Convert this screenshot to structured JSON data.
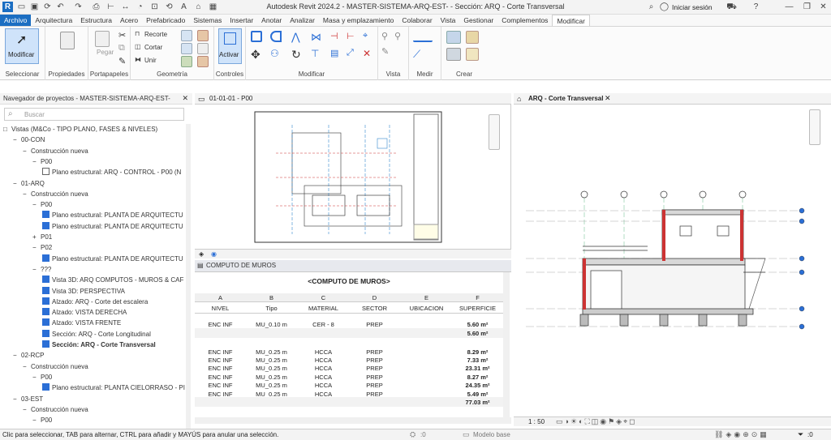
{
  "app": {
    "title": "Autodesk Revit 2024.2 - MASTER-SISTEMA-ARQ-EST- - Sección: ARQ - Corte Transversal",
    "signin": "Iniciar sesión"
  },
  "menu": {
    "tabs": [
      "Archivo",
      "Arquitectura",
      "Estructura",
      "Acero",
      "Prefabricado",
      "Sistemas",
      "Insertar",
      "Anotar",
      "Analizar",
      "Masa y emplazamiento",
      "Colaborar",
      "Vista",
      "Gestionar",
      "Complementos",
      "Modificar"
    ]
  },
  "ribbon": {
    "modify_label": "Modificar",
    "paste_label": "Pegar",
    "recorte_label": "Recorte",
    "cortar_label": "Cortar",
    "unir_label": "Unir",
    "activar_label": "Activar",
    "groups": [
      "Seleccionar",
      "Propiedades",
      "Portapapeles",
      "Geometría",
      "Controles",
      "Modificar",
      "Vista",
      "Medir",
      "Crear"
    ]
  },
  "browser": {
    "header": "Navegador de proyectos - MASTER-SISTEMA-ARQ-EST-",
    "search_placeholder": "Buscar",
    "items": [
      {
        "text": "Vistas (M&Co - TIPO PLANO, FASES & NIVELES)",
        "prefix": "□",
        "level": 0
      },
      {
        "text": "00-CON",
        "prefix": "−",
        "level": 1
      },
      {
        "text": "Construcción nueva",
        "prefix": "−",
        "level": 2
      },
      {
        "text": "P00",
        "prefix": "−",
        "level": 3
      },
      {
        "text": "Plano estructural: ARQ - CONTROL - P00 (N",
        "prefix": "",
        "level": 4,
        "icon": "plain"
      },
      {
        "text": "01-ARQ",
        "prefix": "−",
        "level": 1
      },
      {
        "text": "Construcción nueva",
        "prefix": "−",
        "level": 2
      },
      {
        "text": "P00",
        "prefix": "−",
        "level": 3
      },
      {
        "text": "Plano estructural: PLANTA DE ARQUITECTU",
        "prefix": "",
        "level": 4,
        "icon": "blue"
      },
      {
        "text": "Plano estructural: PLANTA DE ARQUITECTU",
        "prefix": "",
        "level": 4,
        "icon": "blue"
      },
      {
        "text": "P01",
        "prefix": "+",
        "level": 3
      },
      {
        "text": "P02",
        "prefix": "−",
        "level": 3
      },
      {
        "text": "Plano estructural: PLANTA DE ARQUITECTU",
        "prefix": "",
        "level": 4,
        "icon": "blue"
      },
      {
        "text": "???",
        "prefix": "−",
        "level": 3
      },
      {
        "text": "Vista 3D: ARQ COMPUTOS - MUROS & CAF",
        "prefix": "",
        "level": 4,
        "icon": "blue"
      },
      {
        "text": "Vista 3D: PERSPECTIVA",
        "prefix": "",
        "level": 4,
        "icon": "blue"
      },
      {
        "text": "Alzado: ARQ - Corte det escalera",
        "prefix": "",
        "level": 4,
        "icon": "blue"
      },
      {
        "text": "Alzado: VISTA DERECHA",
        "prefix": "",
        "level": 4,
        "icon": "blue"
      },
      {
        "text": "Alzado: VISTA FRENTE",
        "prefix": "",
        "level": 4,
        "icon": "blue"
      },
      {
        "text": "Sección: ARQ - Corte Longitudinal",
        "prefix": "",
        "level": 4,
        "icon": "blue"
      },
      {
        "text": "Sección: ARQ - Corte Transversal",
        "prefix": "",
        "level": 4,
        "icon": "blue",
        "bold": true
      },
      {
        "text": "02-RCP",
        "prefix": "−",
        "level": 1
      },
      {
        "text": "Construcción nueva",
        "prefix": "−",
        "level": 2
      },
      {
        "text": "P00",
        "prefix": "−",
        "level": 3
      },
      {
        "text": "Plano estructural: PLANTA CIELORRASO - PI",
        "prefix": "",
        "level": 4,
        "icon": "blue"
      },
      {
        "text": "03-EST",
        "prefix": "−",
        "level": 1
      },
      {
        "text": "Construcción nueva",
        "prefix": "−",
        "level": 2
      },
      {
        "text": "P00",
        "prefix": "−",
        "level": 3
      }
    ]
  },
  "views": {
    "sheet_tab": "01-01-01 - P00",
    "section_tab": "ARQ - Corte Transversal",
    "scale": "1 : 50"
  },
  "schedule": {
    "tab": "COMPUTO DE MUROS",
    "title": "<COMPUTO DE MUROS>",
    "letters": [
      "A",
      "B",
      "C",
      "D",
      "E",
      "F"
    ],
    "headers": [
      "NIVEL",
      "Tipo",
      "MATERIAL",
      "SECTOR",
      "UBICACION",
      "SUPERFICIE"
    ],
    "rows": [
      [
        "ENC INF",
        "MU_0.10 m",
        "CER - 8",
        "PREP",
        "",
        "5.60 m²"
      ],
      [
        "",
        "",
        "",
        "",
        "",
        "5.60 m²"
      ],
      [
        "ENC INF",
        "MU_0.25 m",
        "HCCA",
        "PREP",
        "",
        "8.29 m²"
      ],
      [
        "ENC INF",
        "MU_0.25 m",
        "HCCA",
        "PREP",
        "",
        "7.33 m²"
      ],
      [
        "ENC INF",
        "MU_0.25 m",
        "HCCA",
        "PREP",
        "",
        "23.31 m²"
      ],
      [
        "ENC INF",
        "MU_0.25 m",
        "HCCA",
        "PREP",
        "",
        "8.27 m²"
      ],
      [
        "ENC INF",
        "MU_0.25 m",
        "HCCA",
        "PREP",
        "",
        "24.35 m²"
      ],
      [
        "ENC INF",
        "MU_0.25 m",
        "HCCA",
        "PREP",
        "",
        "5.49 m²"
      ],
      [
        "",
        "",
        "",
        "",
        "",
        "77.03 m²"
      ]
    ]
  },
  "status": {
    "hint": "Clic para seleccionar, TAB para alternar, CTRL para añadir y MAYÚS para anular una selección.",
    "model": "Modelo base",
    "count1": ":0",
    "count2": ":0"
  }
}
